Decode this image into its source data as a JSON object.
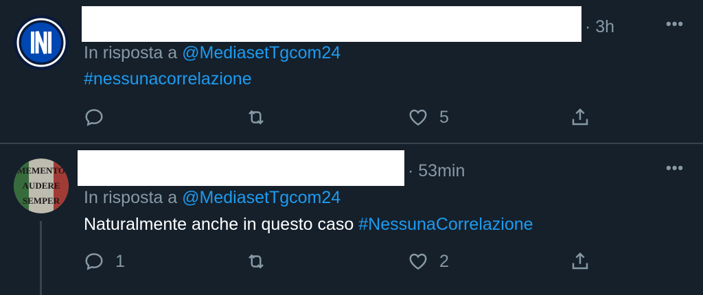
{
  "tweets": [
    {
      "time": "· 3h",
      "reply_prefix": "In risposta a",
      "reply_to": "@MediasetTgcom24",
      "text_plain": "",
      "text_hashtag": "#nessunacorrelazione",
      "likes": "5",
      "replies": "",
      "avatar": "inter-logo-avatar"
    },
    {
      "time": "· 53min",
      "reply_prefix": "In risposta a",
      "reply_to": "@MediasetTgcom24",
      "text_plain": "Naturalmente anche in questo caso ",
      "text_hashtag": "#NessunaCorrelazione",
      "likes": "2",
      "replies": "1",
      "avatar": "memento-audere-semper-avatar",
      "avatar_text": [
        "MEMENTO",
        "AUDERE",
        "SEMPER"
      ]
    }
  ],
  "more_label": "•••",
  "colors": {
    "background": "#15202b",
    "accent": "#1d9bf0",
    "muted": "#8899a6",
    "divider": "#38444d"
  }
}
